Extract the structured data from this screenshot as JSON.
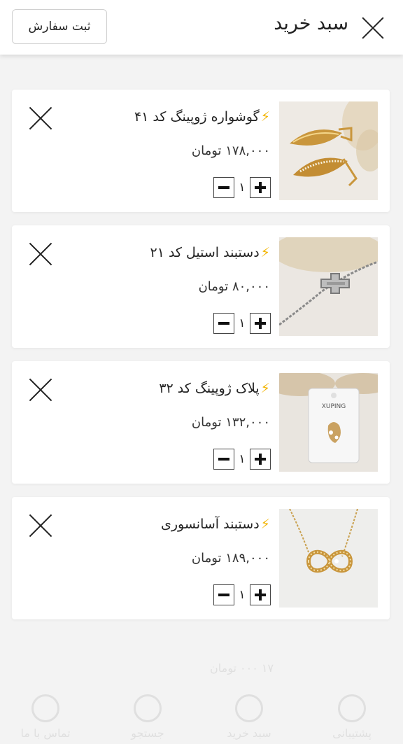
{
  "header": {
    "title": "سبد خرید",
    "order_button": "ثبت سفارش"
  },
  "cart": {
    "items": [
      {
        "name": "گوشواره ژوپینگ کد ۴۱",
        "price": "۱۷۸,۰۰۰ تومان",
        "qty": "۱"
      },
      {
        "name": "دستبند استیل کد ۲۱",
        "price": "۸۰,۰۰۰ تومان",
        "qty": "۱"
      },
      {
        "name": "پلاک ژوپینگ کد ۳۲",
        "price": "۱۳۲,۰۰۰ تومان",
        "qty": "۱"
      },
      {
        "name": "دستبند آسانسوری",
        "price": "۱۸۹,۰۰۰ تومان",
        "qty": "۱"
      }
    ],
    "package_label": "XUPING"
  },
  "background": {
    "nav_items": [
      "پشتیبانی",
      "جستجو",
      "سبد خرید",
      "تماس با ما"
    ],
    "ghost_price": "۱۷ ۰۰۰ تومان"
  },
  "colors": {
    "bolt": "#f2b400",
    "background": "#f3f3f3"
  }
}
